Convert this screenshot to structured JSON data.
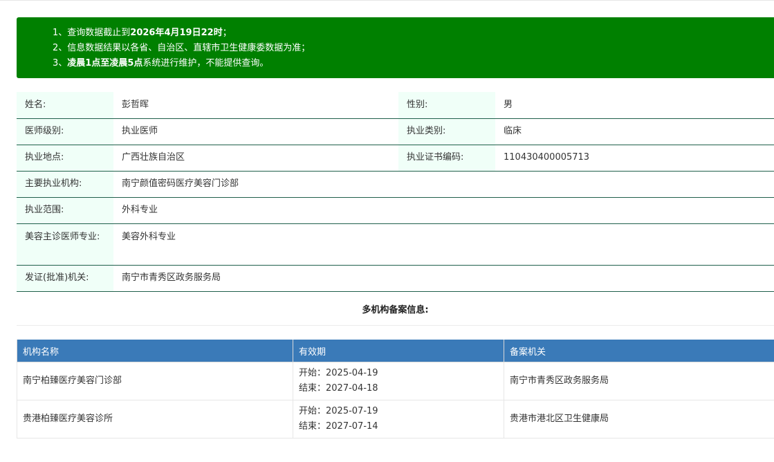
{
  "notice": {
    "line1_prefix": "1、查询数据截止到",
    "line1_bold": "2026年4月19日22时",
    "line1_suffix": "；",
    "line2": "2、信息数据结果以各省、自治区、直辖市卫生健康委数据为准；",
    "line3_prefix": "3、",
    "line3_bold": "凌晨1点至凌晨5点",
    "line3_suffix": "系统进行维护，不能提供查询。"
  },
  "info": {
    "name_label": "姓名:",
    "name_value": "彭哲晖",
    "gender_label": "性别:",
    "gender_value": "男",
    "level_label": "医师级别:",
    "level_value": "执业医师",
    "category_label": "执业类别:",
    "category_value": "临床",
    "location_label": "执业地点:",
    "location_value": "广西壮族自治区",
    "cert_label": "执业证书编码:",
    "cert_value": "110430400005713",
    "org_label": "主要执业机构:",
    "org_value": "南宁颜值密码医疗美容门诊部",
    "scope_label": "执业范围:",
    "scope_value": "外科专业",
    "cosmetic_label": "美容主诊医师专业:",
    "cosmetic_value": "美容外科专业",
    "issuer_label": "发证(批准)机关:",
    "issuer_value": "南宁市青秀区政务服务局"
  },
  "records": {
    "title": "多机构备案信息:",
    "headers": [
      "机构名称",
      "有效期",
      "备案机关"
    ],
    "rows": [
      {
        "org": "南宁柏臻医疗美容门诊部",
        "start": "开始：2025-04-19",
        "end": "结束：2027-04-18",
        "authority": "南宁市青秀区政务服务局"
      },
      {
        "org": "贵港柏臻医疗美容诊所",
        "start": "开始：2025-07-19",
        "end": "结束：2027-07-14",
        "authority": "贵港市港北区卫生健康局"
      }
    ]
  }
}
